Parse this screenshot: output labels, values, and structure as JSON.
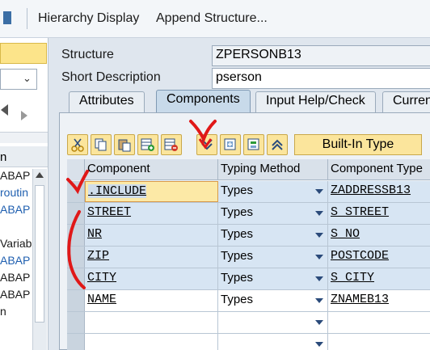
{
  "menu": {
    "items": [
      "Hierarchy Display",
      "Append Structure..."
    ]
  },
  "left_pane": {
    "header": "n",
    "items": [
      "ABAP",
      "routin",
      "ABAP",
      "",
      "Variab",
      "ABAP",
      "ABAP",
      "ABAP",
      "n"
    ]
  },
  "header_fields": {
    "structure_label": "Structure",
    "structure_value": "ZPERSONB13",
    "short_desc_label": "Short Description",
    "short_desc_value": "pserson"
  },
  "tabs": [
    {
      "label": "Attributes",
      "active": false
    },
    {
      "label": "Components",
      "active": true
    },
    {
      "label": "Input Help/Check",
      "active": false
    },
    {
      "label": "Curren",
      "active": false
    }
  ],
  "toolbar": {
    "icons": [
      "cut-icon",
      "copy-icon",
      "paste-icon",
      "insert-row-icon",
      "delete-row-icon",
      "expand-include-icon",
      "new-field-icon",
      "structure-icon",
      "collapse-up-icon"
    ],
    "builtin_type_label": "Built-In Type"
  },
  "table": {
    "columns": [
      "Component",
      "Typing Method",
      "Component Type"
    ],
    "rows": [
      {
        "component": ".INCLUDE",
        "typing": "Types",
        "type": "ZADDRESSB13"
      },
      {
        "component": "STREET",
        "typing": "Types",
        "type": "S_STREET"
      },
      {
        "component": "NR",
        "typing": "Types",
        "type": "S_NO"
      },
      {
        "component": "ZIP",
        "typing": "Types",
        "type": "POSTCODE"
      },
      {
        "component": "CITY",
        "typing": "Types",
        "type": "S_CITY"
      },
      {
        "component": "NAME",
        "typing": "Types",
        "type": "ZNAMEB13"
      },
      {
        "component": "",
        "typing": "",
        "type": ""
      },
      {
        "component": "",
        "typing": "",
        "type": ""
      }
    ]
  },
  "colors": {
    "accent_yellow": "#fbe59c",
    "row_blue": "#d7e5f3",
    "annotation_red": "#e01818"
  }
}
